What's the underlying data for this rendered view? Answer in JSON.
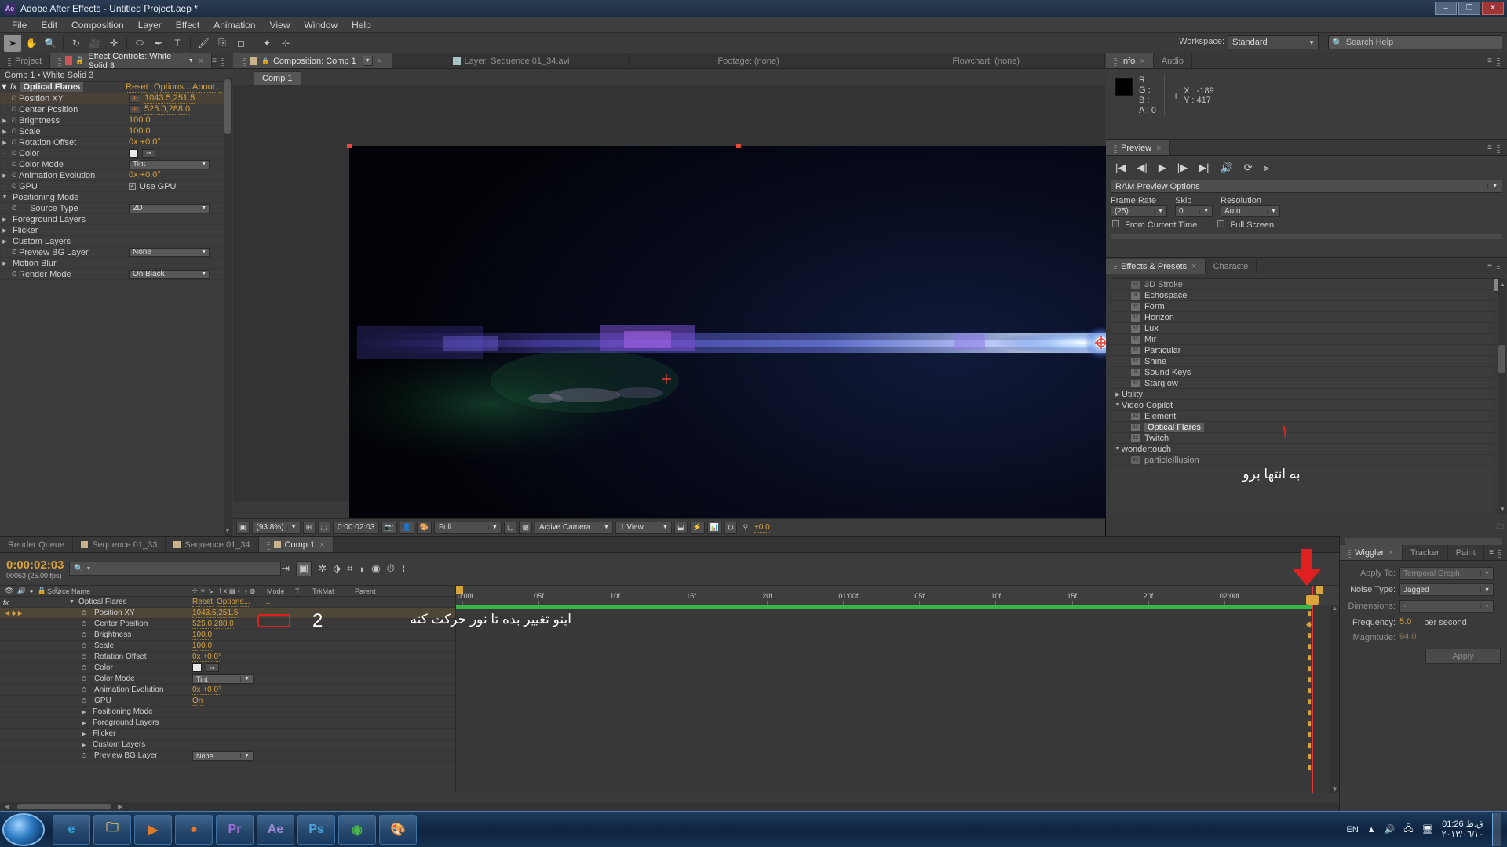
{
  "window": {
    "title": "Adobe After Effects - Untitled Project.aep *",
    "logo": "Ae",
    "buttons": {
      "minimize": "–",
      "maximize": "❐",
      "close": "✕"
    }
  },
  "menubar": [
    "File",
    "Edit",
    "Composition",
    "Layer",
    "Effect",
    "Animation",
    "View",
    "Window",
    "Help"
  ],
  "toolbar": {
    "workspace_label": "Workspace:",
    "workspace_value": "Standard",
    "search_help": "Search Help",
    "tools": [
      "selection-tool",
      "hand-tool",
      "zoom-tool",
      "rotation-tool",
      "camera-tool",
      "pan-behind-tool",
      "shape-tool",
      "pen-tool",
      "text-tool",
      "brush-tool",
      "clone-tool",
      "eraser-tool",
      "roto-brush-tool",
      "puppet-tool"
    ]
  },
  "effect_controls": {
    "tab_project": "Project",
    "tab_title": "Effect Controls: White Solid 3",
    "subtitle": "Comp 1 • White Solid 3",
    "effect_name": "Optical Flares",
    "reset": "Reset",
    "options": "Options...",
    "about": "About...",
    "rows": [
      {
        "name": "Position XY",
        "value": "1043.5,251.5",
        "type": "point",
        "selected": true
      },
      {
        "name": "Center Position",
        "value": "525.0,288.0",
        "type": "point",
        "selected": false
      },
      {
        "name": "Brightness",
        "value": "100.0",
        "type": "number",
        "twirl": true
      },
      {
        "name": "Scale",
        "value": "100.0",
        "type": "number",
        "twirl": true
      },
      {
        "name": "Rotation Offset",
        "value": "0x +0.0°",
        "type": "number",
        "twirl": true
      },
      {
        "name": "Color",
        "value": "",
        "type": "color"
      },
      {
        "name": "Color Mode",
        "value": "Tint",
        "type": "dropdown"
      },
      {
        "name": "Animation Evolution",
        "value": "0x +0.0°",
        "type": "number",
        "twirl": true
      },
      {
        "name": "GPU",
        "value": "Use GPU",
        "type": "checkbox"
      },
      {
        "name": "Positioning Mode",
        "value": "",
        "type": "group",
        "open": true
      },
      {
        "name": "Source Type",
        "value": "2D",
        "type": "dropdown",
        "indent": true
      },
      {
        "name": "Foreground Layers",
        "value": "",
        "type": "group"
      },
      {
        "name": "Flicker",
        "value": "",
        "type": "group"
      },
      {
        "name": "Custom Layers",
        "value": "",
        "type": "group"
      },
      {
        "name": "Preview BG Layer",
        "value": "None",
        "type": "dropdown"
      },
      {
        "name": "Motion Blur",
        "value": "",
        "type": "group"
      },
      {
        "name": "Render Mode",
        "value": "On Black",
        "type": "dropdown"
      }
    ]
  },
  "viewer": {
    "tabs": [
      {
        "label": "Composition: Comp 1",
        "active": true
      },
      {
        "label": "Layer: Sequence 01_34.avi",
        "active": false
      },
      {
        "label": "Footage: (none)",
        "active": false
      },
      {
        "label": "Flowchart: (none)",
        "active": false
      }
    ],
    "sub_tab": "Comp 1",
    "bottom": {
      "zoom": "(93.8%)",
      "time": "0:00:02:03",
      "resolution": "Full",
      "camera": "Active Camera",
      "views": "1 View",
      "exposure": "+0.0"
    }
  },
  "info_panel": {
    "tabs": [
      "Info",
      "Audio"
    ],
    "r": "R :",
    "g": "G :",
    "b": "B :",
    "a": "A : 0",
    "x": "X : -189",
    "y": "Y : 417"
  },
  "preview_panel": {
    "tab": "Preview",
    "ram_options": "RAM Preview Options",
    "frame_rate_label": "Frame Rate",
    "frame_rate_value": "(25)",
    "skip_label": "Skip",
    "skip_value": "0",
    "resolution_label": "Resolution",
    "resolution_value": "Auto",
    "from_current_time": "From Current Time",
    "full_screen": "Full Screen",
    "transport": [
      "first-frame-icon",
      "previous-frame-icon",
      "play-icon",
      "next-frame-icon",
      "last-frame-icon",
      "audio-icon",
      "loop-icon",
      "ram-preview-icon"
    ]
  },
  "effects_presets": {
    "tabs": [
      "Effects & Presets",
      "Characte"
    ],
    "search_placeholder": "",
    "items": [
      {
        "label": "3D Stroke",
        "kind": "effect",
        "clipped": true
      },
      {
        "label": "Echospace",
        "kind": "effect8"
      },
      {
        "label": "Form",
        "kind": "effect"
      },
      {
        "label": "Horizon",
        "kind": "effect"
      },
      {
        "label": "Lux",
        "kind": "effect"
      },
      {
        "label": "Mir",
        "kind": "effect"
      },
      {
        "label": "Particular",
        "kind": "effect"
      },
      {
        "label": "Shine",
        "kind": "effect"
      },
      {
        "label": "Sound Keys",
        "kind": "effect8"
      },
      {
        "label": "Starglow",
        "kind": "effect"
      },
      {
        "label": "Utility",
        "kind": "group"
      },
      {
        "label": "Video Copilot",
        "kind": "group-open"
      },
      {
        "label": "Element",
        "kind": "effect"
      },
      {
        "label": "Optical Flares",
        "kind": "effect",
        "selected": true
      },
      {
        "label": "Twitch",
        "kind": "effect"
      },
      {
        "label": "wondertouch",
        "kind": "group-open"
      },
      {
        "label": "particleIllusion",
        "kind": "effect",
        "clipped": true
      }
    ]
  },
  "wiggler": {
    "tabs": [
      "Wiggler",
      "Tracker",
      "Paint"
    ],
    "apply_to_label": "Apply To:",
    "apply_to_value": "Temporal Graph",
    "noise_type_label": "Noise Type:",
    "noise_type_value": "Jagged",
    "dimensions_label": "Dimensions:",
    "dimensions_value": "-",
    "frequency_label": "Frequency:",
    "frequency_value": "5.0",
    "frequency_unit": "per second",
    "magnitude_label": "Magnitude:",
    "magnitude_value": "94.0",
    "apply_button": "Apply"
  },
  "timeline": {
    "tabs": [
      {
        "label": "Render Queue",
        "active": false,
        "sq": false
      },
      {
        "label": "Sequence 01_33",
        "active": false,
        "sq": true
      },
      {
        "label": "Sequence 01_34",
        "active": false,
        "sq": true
      },
      {
        "label": "Comp 1",
        "active": true,
        "sq": true
      }
    ],
    "current_time": "0:00:02:03",
    "frame_info": "00053 (25.00 fps)",
    "columns": [
      "#",
      "Source Name",
      "Mode",
      "T",
      "TrkMat",
      "Parent"
    ],
    "effect_row": {
      "name": "Optical Flares",
      "reset": "Reset",
      "options": "Options...",
      "more": "..."
    },
    "rows": [
      {
        "name": "Position XY",
        "value": "1043.5,251.5",
        "type": "point",
        "selected": true,
        "keyframed": true
      },
      {
        "name": "Center Position",
        "value": "525.0,288.0",
        "type": "point"
      },
      {
        "name": "Brightness",
        "value": "100.0",
        "type": "number"
      },
      {
        "name": "Scale",
        "value": "100.0",
        "type": "number"
      },
      {
        "name": "Rotation Offset",
        "value": "0x +0.0°",
        "type": "number"
      },
      {
        "name": "Color",
        "value": "",
        "type": "color"
      },
      {
        "name": "Color Mode",
        "value": "Tint",
        "type": "dropdown"
      },
      {
        "name": "Animation Evolution",
        "value": "0x +0.0°",
        "type": "number"
      },
      {
        "name": "GPU",
        "value": "On",
        "type": "number"
      },
      {
        "name": "Positioning Mode",
        "value": "",
        "type": "group"
      },
      {
        "name": "Foreground Layers",
        "value": "",
        "type": "group"
      },
      {
        "name": "Flicker",
        "value": "",
        "type": "group"
      },
      {
        "name": "Custom Layers",
        "value": "",
        "type": "group"
      },
      {
        "name": "Preview BG Layer",
        "value": "None",
        "type": "dropdown"
      }
    ],
    "ruler_ticks": [
      "0:00f",
      "05f",
      "10f",
      "15f",
      "20f",
      "01:00f",
      "05f",
      "10f",
      "15f",
      "20f",
      "02:00f"
    ]
  },
  "annotations": {
    "note_1_number": "١",
    "note_1_text": "به انتها برو",
    "note_2_number": "2",
    "note_2_text": "اینو تغییر بده تا نور حرکت کنه"
  },
  "taskbar": {
    "apps": [
      {
        "name": "internet-explorer",
        "glyph": "e",
        "color": "#2f9fe0"
      },
      {
        "name": "file-explorer",
        "glyph": "🗀",
        "color": "#e8c35a"
      },
      {
        "name": "media-player",
        "glyph": "▶",
        "color": "#e07b2a"
      },
      {
        "name": "firefox",
        "glyph": "●",
        "color": "#e8732a"
      },
      {
        "name": "premiere-pro",
        "glyph": "Pr",
        "color": "#9a6fd0"
      },
      {
        "name": "after-effects",
        "glyph": "Ae",
        "color": "#9b8ad4"
      },
      {
        "name": "photoshop",
        "glyph": "Ps",
        "color": "#4aa3dd"
      },
      {
        "name": "chrome",
        "glyph": "◉",
        "color": "#4ab34a"
      },
      {
        "name": "paint",
        "glyph": "🎨",
        "color": "#cfd6df"
      }
    ],
    "language": "EN",
    "time": "ق.ظ 01:26",
    "date": "٢٠١٣/٠٦/١٠"
  },
  "colors": {
    "accent_orange": "#d6a23c",
    "red_marker": "#e02020",
    "green_bar": "#35b545"
  }
}
